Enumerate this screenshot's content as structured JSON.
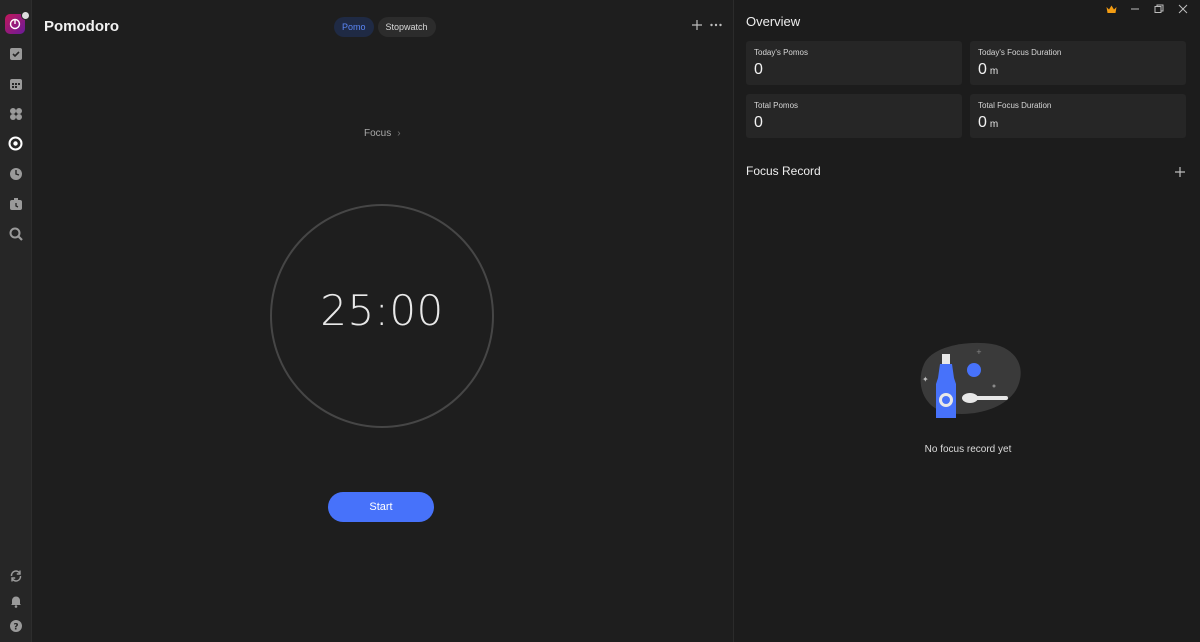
{
  "sidebar": {
    "icons": [
      "app-avatar",
      "task-check-icon",
      "calendar-icon",
      "grid-icon",
      "pomodoro-icon",
      "habit-icon",
      "countdown-icon",
      "search-icon",
      "sync-icon",
      "bell-icon",
      "help-icon"
    ],
    "active": "pomodoro-icon"
  },
  "header": {
    "title": "Pomodoro",
    "tabs": [
      {
        "label": "Pomo",
        "active": true
      },
      {
        "label": "Stopwatch",
        "active": false
      }
    ]
  },
  "timer": {
    "mode_label": "Focus",
    "time": "25:00",
    "start_label": "Start"
  },
  "overview": {
    "title": "Overview",
    "cards": [
      {
        "label": "Today's Pomos",
        "value": "0",
        "unit": ""
      },
      {
        "label": "Today's Focus Duration",
        "value": "0",
        "unit": "m"
      },
      {
        "label": "Total Pomos",
        "value": "0",
        "unit": ""
      },
      {
        "label": "Total Focus Duration",
        "value": "0",
        "unit": "m"
      }
    ]
  },
  "focus_record": {
    "title": "Focus Record",
    "empty_text": "No focus record yet"
  },
  "colors": {
    "accent": "#4772fa",
    "bg": "#1e1e1e",
    "card": "#262626",
    "crown": "#f39c12"
  }
}
